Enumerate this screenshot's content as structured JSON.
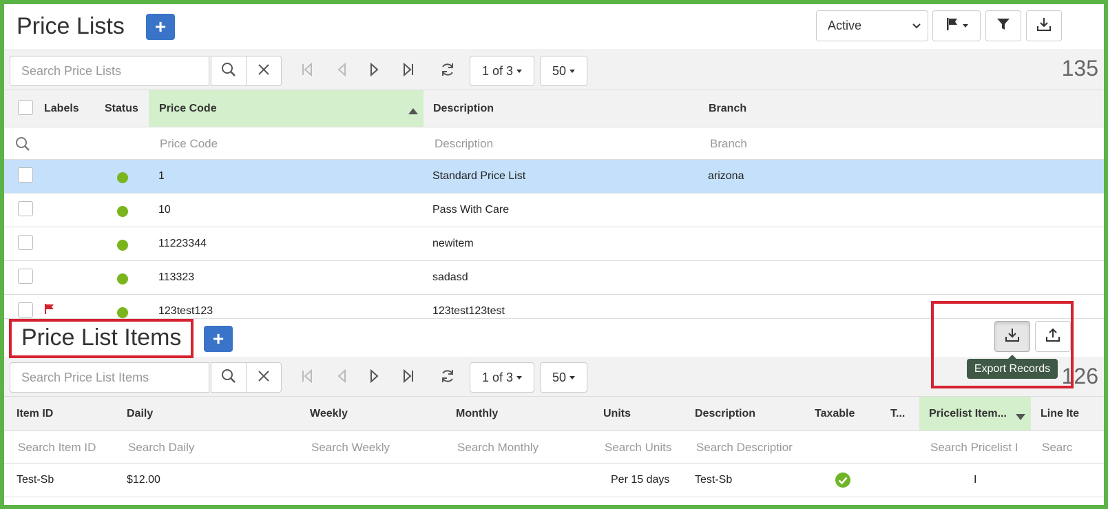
{
  "price_lists": {
    "title": "Price Lists",
    "add_label": "+",
    "status_filter": "Active",
    "search_placeholder": "Search Price Lists",
    "page_label": "1 of 3",
    "page_size": "50",
    "record_count": "135",
    "columns": {
      "labels": "Labels",
      "status": "Status",
      "price_code": "Price Code",
      "description": "Description",
      "branch": "Branch"
    },
    "filters": {
      "price_code": "Price Code",
      "description": "Description",
      "branch": "Branch"
    },
    "rows": [
      {
        "price_code": "1",
        "description": "Standard Price List",
        "branch": "arizona",
        "selected": true
      },
      {
        "price_code": "10",
        "description": "Pass With Care",
        "branch": ""
      },
      {
        "price_code": "11223344",
        "description": "newitem",
        "branch": ""
      },
      {
        "price_code": "113323",
        "description": "sadasd",
        "branch": ""
      },
      {
        "price_code": "123test123",
        "description": "123test123test",
        "branch": "",
        "flagged": true
      }
    ]
  },
  "price_list_items": {
    "title": "Price List Items",
    "add_label": "+",
    "search_placeholder": "Search Price List Items",
    "page_label": "1 of 3",
    "page_size": "50",
    "record_count": "126",
    "tooltip": "Export Records",
    "columns": {
      "item_id": "Item ID",
      "daily": "Daily",
      "weekly": "Weekly",
      "monthly": "Monthly",
      "units": "Units",
      "description": "Description",
      "taxable": "Taxable",
      "t": "T...",
      "pricelist_item": "Pricelist Item...",
      "line_item": "Line Ite"
    },
    "filters": {
      "item_id": "Search Item ID",
      "daily": "Search Daily",
      "weekly": "Search Weekly",
      "monthly": "Search Monthly",
      "units": "Search Units",
      "description": "Search Descriptior",
      "pricelist_item": "Search Pricelist I",
      "line_item": "Searc"
    },
    "rows": [
      {
        "item_id": "Test-Sb",
        "daily": "$12.00",
        "weekly": "",
        "monthly": "",
        "units": "Per 15 days",
        "description": "Test-Sb",
        "pricelist_item": "I"
      }
    ]
  },
  "colors": {
    "frame": "#5cb345",
    "accent_blue": "#3a74c9",
    "status_green": "#7ab51d",
    "selected_row": "#c5e0fa",
    "sorted_header": "#d3efcb",
    "highlight_red": "#d62230",
    "tooltip_bg": "#3f5946"
  }
}
